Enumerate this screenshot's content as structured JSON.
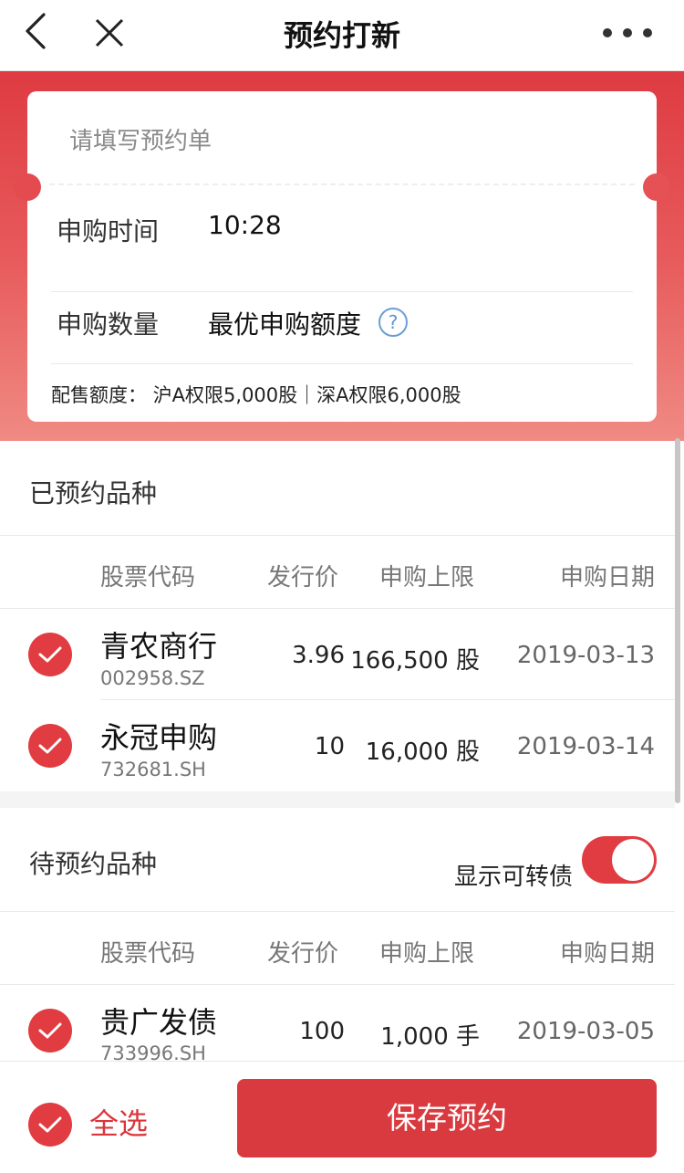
{
  "header": {
    "title": "预约打新",
    "back_icon": "chevron-left-icon",
    "close_icon": "close-icon",
    "more_icon": "more-dots-icon"
  },
  "form": {
    "title": "请填写预约单",
    "time_label": "申购时间",
    "time_value": "10:28",
    "quantity_label": "申购数量",
    "quantity_value": "最优申购额度",
    "help_glyph": "?",
    "quota_text": "配售额度：  沪A权限5,000股｜深A权限6,000股"
  },
  "reserved": {
    "title": "已预约品种",
    "columns": [
      "股票代码",
      "发行价",
      "申购上限",
      "申购日期"
    ],
    "rows": [
      {
        "name": "青农商行",
        "code": "002958.SZ",
        "price": "3.96",
        "limit": "166,500 股",
        "date": "2019-03-13",
        "checked": true
      },
      {
        "name": "永冠申购",
        "code": "732681.SH",
        "price": "10",
        "limit": "16,000 股",
        "date": "2019-03-14",
        "checked": true
      }
    ]
  },
  "pending": {
    "title": "待预约品种",
    "toggle_label": "显示可转债",
    "toggle_on": true,
    "columns": [
      "股票代码",
      "发行价",
      "申购上限",
      "申购日期"
    ],
    "rows": [
      {
        "name": "贵广发债",
        "code": "733996.SH",
        "price": "100",
        "limit": "1,000 手",
        "date": "2019-03-05",
        "checked": true
      }
    ]
  },
  "footer": {
    "select_all_label": "全选",
    "save_label": "保存预约"
  },
  "colors": {
    "accent": "#d93a3f",
    "hero_top": "#de3b42",
    "hero_bottom": "#f08a83"
  }
}
